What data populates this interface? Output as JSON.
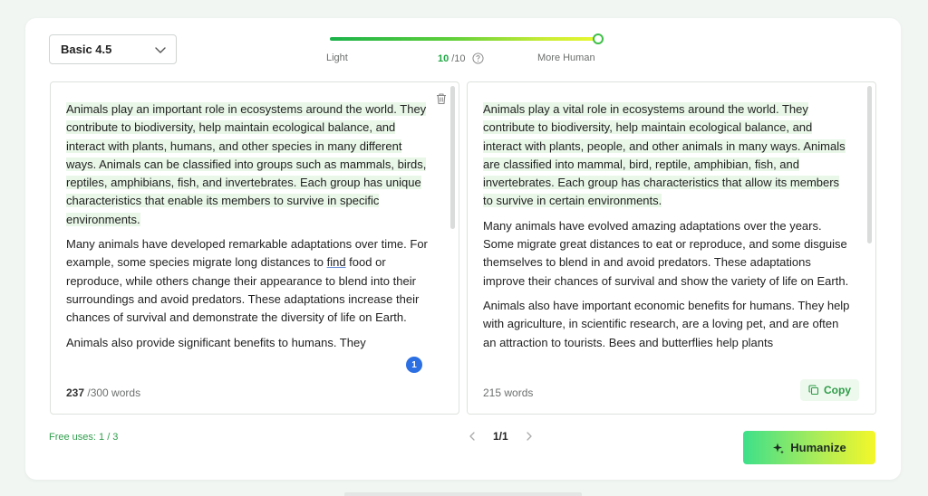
{
  "model_select": {
    "label": "Basic 4.5"
  },
  "slider": {
    "left_label": "Light",
    "right_label": "More Human",
    "current": "10",
    "total": "/10",
    "level_fraction": 1.0
  },
  "input_panel": {
    "paragraphs": [
      {
        "highlighted": true,
        "text": "Animals play an important role in ecosystems around the world. They contribute to biodiversity, help maintain ecological balance, and interact with plants, humans, and other species in many different ways. Animals can be classified into groups such as mammals, birds, reptiles, amphibians, fish, and invertebrates. Each group has unique characteristics that enable its members to survive in specific environments."
      },
      {
        "highlighted": false,
        "before": "Many animals have developed remarkable adaptations over time. For example, some species migrate long distances to ",
        "underlined": "find",
        "after": " food or reproduce, while others change their appearance to blend into their surroundings and avoid predators. These adaptations increase their chances of survival and demonstrate the diversity of life on Earth."
      },
      {
        "highlighted": false,
        "text": "Animals also provide significant benefits to humans. They"
      }
    ],
    "word_count": "237",
    "word_limit": " /300 words",
    "badge": "1"
  },
  "output_panel": {
    "paragraphs": [
      {
        "highlighted": true,
        "text": " Animals play a vital role in ecosystems around the world. They contribute to biodiversity, help maintain ecological balance, and interact with plants, people, and other animals in many ways. Animals are classified into mammal, bird, reptile, amphibian, fish, and invertebrates. Each group has characteristics that allow its members to survive in certain environments."
      },
      {
        "highlighted": false,
        "text": "Many animals have evolved amazing adaptations over the years. Some migrate great distances to eat or reproduce, and some disguise themselves to blend in and avoid predators. These adaptations improve their chances of survival and show the variety of life on Earth."
      },
      {
        "highlighted": false,
        "text": "Animals also have important economic benefits for humans. They help with agriculture, in scientific research, are a loving pet, and are often an attraction to tourists. Bees and butterflies help plants"
      }
    ],
    "word_count": "215 words",
    "copy_label": "Copy"
  },
  "footer": {
    "free_uses": "Free uses: 1 / 3",
    "page": "1/1",
    "humanize_label": "Humanize"
  },
  "colors": {
    "accent_green": "#2e9c47",
    "badge_blue": "#2b6fe3",
    "highlight": "#e9f7e8"
  },
  "icons": [
    "chevron-down-icon",
    "help-icon",
    "trash-icon",
    "copy-icon",
    "chevron-left-icon",
    "chevron-right-icon",
    "sparkle-icon"
  ]
}
